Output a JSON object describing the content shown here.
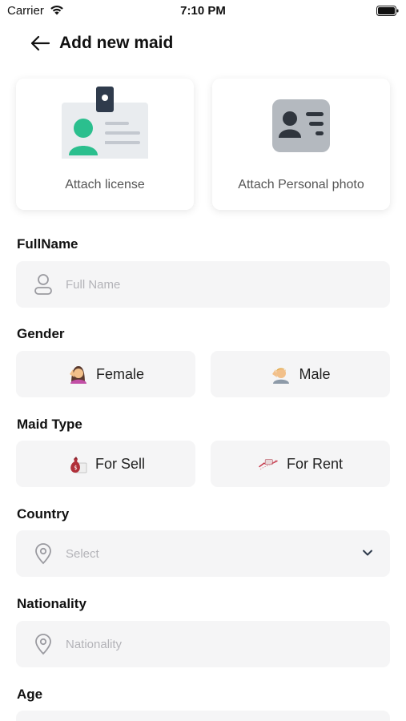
{
  "status": {
    "carrier": "Carrier",
    "time": "7:10 PM"
  },
  "header": {
    "title": "Add new maid",
    "back_icon": "arrow-left-icon"
  },
  "attach": {
    "license_label": "Attach license",
    "photo_label": "Attach Personal photo"
  },
  "fields": {
    "fullname": {
      "label": "FullName",
      "placeholder": "Full Name",
      "icon": "user-icon"
    },
    "gender": {
      "label": "Gender",
      "options": [
        "Female",
        "Male"
      ]
    },
    "maid_type": {
      "label": "Maid Type",
      "options": [
        "For Sell",
        "For Rent"
      ]
    },
    "country": {
      "label": "Country",
      "placeholder": "Select",
      "icon": "location-pin-icon"
    },
    "nationality": {
      "label": "Nationality",
      "placeholder": "Nationality",
      "icon": "location-pin-icon"
    },
    "age": {
      "label": "Age"
    }
  },
  "colors": {
    "input_bg": "#f5f5f6",
    "placeholder": "#b3b3b8",
    "card_icon": "#2bbf8e"
  }
}
